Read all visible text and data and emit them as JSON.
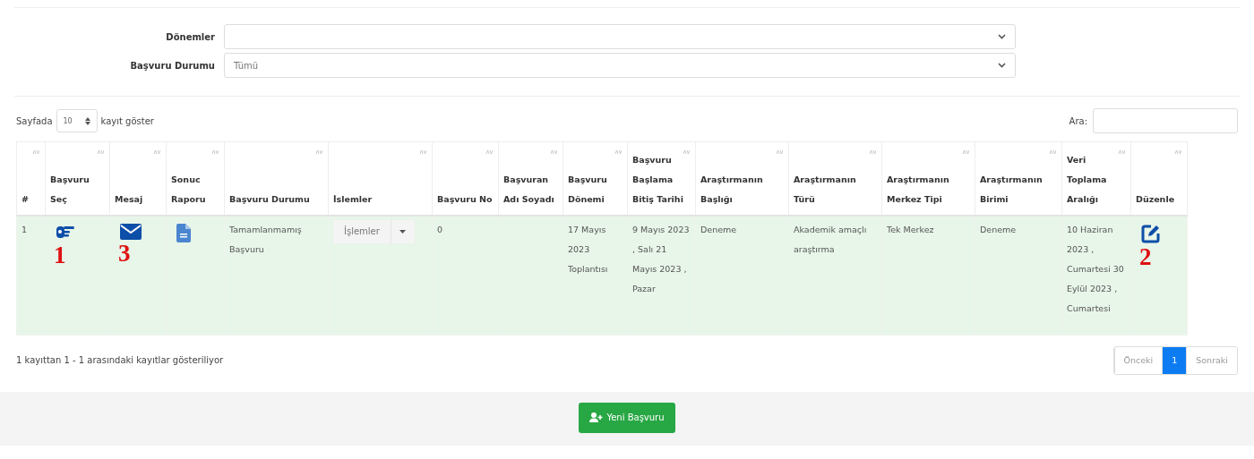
{
  "filters": [
    {
      "label": "Dönemler"
    },
    {
      "label": "Başvuru Durumu",
      "value": "Tümü"
    }
  ],
  "length_menu": {
    "prefix": "Sayfada",
    "value": "10",
    "suffix": "kayıt göster"
  },
  "search": {
    "label": "Ara:"
  },
  "table": {
    "columns": [
      "#",
      "Başvuru Seç",
      "Mesaj",
      "Sonuc Raporu",
      "Başvuru Durumu",
      "İslemler",
      "Başvuru No",
      "Başvuran Adı Soyadı",
      "Başvuru Dönemi",
      "Başvuru Başlama Bitiş Tarihi",
      "Araştırmanın Başlığı",
      "Araştırmanın Türü",
      "Araştırmanın Merkez Tipi",
      "Araştırmanın Birimi",
      "Veri Toplama Aralığı",
      "Düzenle"
    ],
    "rows": [
      {
        "cells": [
          {
            "kind": "text",
            "text": "1"
          },
          {
            "kind": "icon",
            "annotation": "1"
          },
          {
            "kind": "icon",
            "annotation": "3"
          },
          {
            "kind": "icon"
          },
          {
            "kind": "text",
            "text": "Tamamlanmamış Başvuru"
          },
          {
            "kind": "dropdown",
            "text": "İşlemler"
          },
          {
            "kind": "text",
            "text": "0"
          },
          {
            "kind": "empty"
          },
          {
            "kind": "text",
            "text": "17 Mayıs 2023 Toplantısı"
          },
          {
            "kind": "text",
            "text": "9 Mayıs 2023 , Salı 21 Mayıs 2023 , Pazar"
          },
          {
            "kind": "text",
            "text": "Deneme"
          },
          {
            "kind": "text",
            "text": "Akademik amaçlı araştırma"
          },
          {
            "kind": "text",
            "text": "Tek Merkez"
          },
          {
            "kind": "text",
            "text": "Deneme"
          },
          {
            "kind": "text",
            "text": "10 Haziran 2023 , Cumartesi 30 Eylül 2023 , Cumartesi"
          },
          {
            "kind": "icon",
            "annotation": "2"
          }
        ]
      }
    ]
  },
  "info": "1 kayıttan 1 - 1 arasındaki kayıtlar gösteriliyor",
  "pagination": [
    {
      "label": "Önceki",
      "selected": false
    },
    {
      "label": "1",
      "selected": true
    },
    {
      "label": "Sonraki",
      "selected": false
    }
  ],
  "new_button": {
    "label": "Yeni Başvuru"
  }
}
